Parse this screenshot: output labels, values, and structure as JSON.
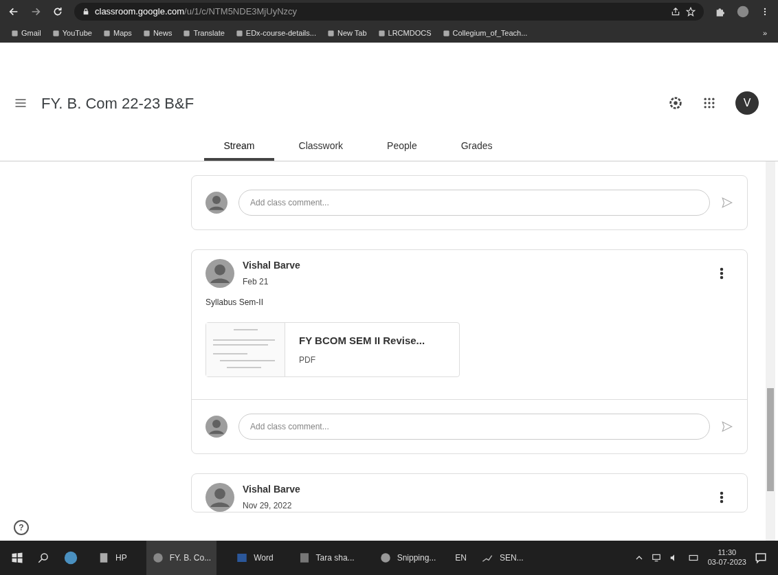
{
  "browser": {
    "url_host": "classroom.google.com",
    "url_path": "/u/1/c/NTM5NDE3MjUyNzcy",
    "bookmarks": [
      "Gmail",
      "YouTube",
      "Maps",
      "News",
      "Translate",
      "EDx-course-details...",
      "New Tab",
      "LRCMDOCS",
      "Collegium_of_Teach..."
    ],
    "more": "»"
  },
  "header": {
    "title": "FY. B. Com 22-23 B&F",
    "avatar_letter": "V"
  },
  "tabs": [
    {
      "label": "Stream",
      "selected": true
    },
    {
      "label": "Classwork",
      "selected": false
    },
    {
      "label": "People",
      "selected": false
    },
    {
      "label": "Grades",
      "selected": false
    }
  ],
  "posts": [
    {
      "comment_placeholder": "Add class comment..."
    },
    {
      "author": "Vishal Barve",
      "date": "Feb 21",
      "text": "Syllabus Sem-II",
      "attachment": {
        "title": "FY BCOM SEM II Revise...",
        "type": "PDF"
      },
      "comment_placeholder": "Add class comment..."
    },
    {
      "author": "Vishal Barve",
      "date": "Nov 29, 2022"
    }
  ],
  "help": "?",
  "taskbar": {
    "apps": [
      "HP",
      "FY. B. Co...",
      "Word",
      "Tara sha...",
      "Snipping..."
    ],
    "language": "EN",
    "weather": "SEN...",
    "time": "11:30",
    "date": "03-07-2023"
  }
}
